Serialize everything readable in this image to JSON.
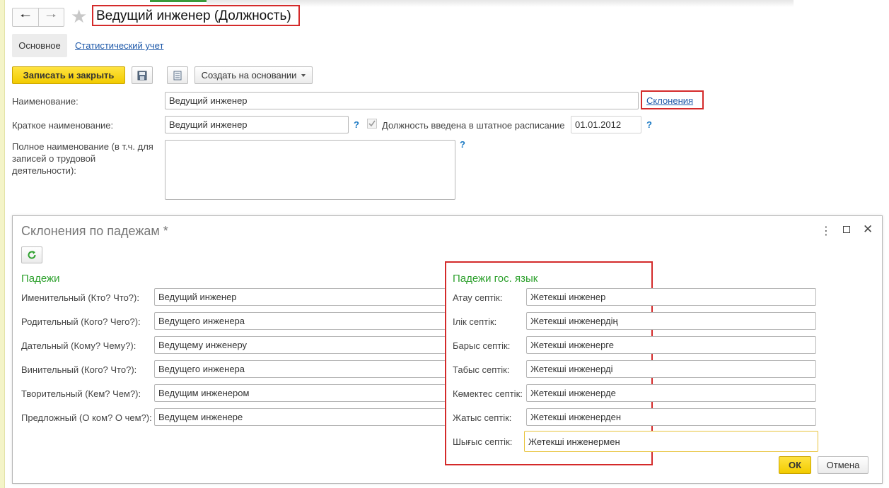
{
  "header": {
    "title": "Ведущий инженер (Должность)"
  },
  "tabs": {
    "main": "Основное",
    "stats": "Статистический учет"
  },
  "toolbar": {
    "save_close": "Записать и закрыть",
    "create_based": "Создать на основании"
  },
  "form": {
    "name_label": "Наименование:",
    "name_value": "Ведущий инженер",
    "declensions_link": "Склонения",
    "short_label": "Краткое наименование:",
    "short_value": "Ведущий инженер",
    "help": "?",
    "staff_checkbox_label": "Должность введена в штатное расписание",
    "staff_checked": true,
    "staff_date": "01.01.2012",
    "full_label": "Полное наименование (в т.ч. для записей о трудовой деятельности):",
    "full_value": ""
  },
  "dialog": {
    "title": "Склонения по падежам *",
    "cases_header": "Падежи",
    "state_header": "Падежи гос. язык",
    "cases": [
      {
        "label": "Именительный (Кто? Что?):",
        "value": "Ведущий инженер"
      },
      {
        "label": "Родительный (Кого? Чего?):",
        "value": "Ведущего инженера"
      },
      {
        "label": "Дательный (Кому? Чему?):",
        "value": "Ведущему инженеру"
      },
      {
        "label": "Винительный (Кого? Что?):",
        "value": "Ведущего инженера"
      },
      {
        "label": "Творительный (Кем? Чем?):",
        "value": "Ведущим инженером"
      },
      {
        "label": "Предложный (О ком? О чем?):",
        "value": "Ведущем инженере"
      }
    ],
    "state_cases": [
      {
        "label": "Атау септік:",
        "value": "Жетекші инженер"
      },
      {
        "label": "Ілік септік:",
        "value": "Жетекші инженердің"
      },
      {
        "label": "Барыс септік:",
        "value": "Жетекші инженерге"
      },
      {
        "label": "Табыс септік:",
        "value": "Жетекші инженерді"
      },
      {
        "label": "Көмектес септік:",
        "value": "Жетекші инженерде"
      },
      {
        "label": "Жатыс септік:",
        "value": "Жетекші инженерден"
      },
      {
        "label": "Шығыс септік:",
        "value": "Жетекші инженермен"
      }
    ],
    "ok": "ОК",
    "cancel": "Отмена"
  },
  "colors": {
    "accent_yellow": "#f2cb00",
    "highlight_red": "#d42a2a",
    "section_green": "#2ea12e",
    "link_blue": "#1c57a8"
  }
}
